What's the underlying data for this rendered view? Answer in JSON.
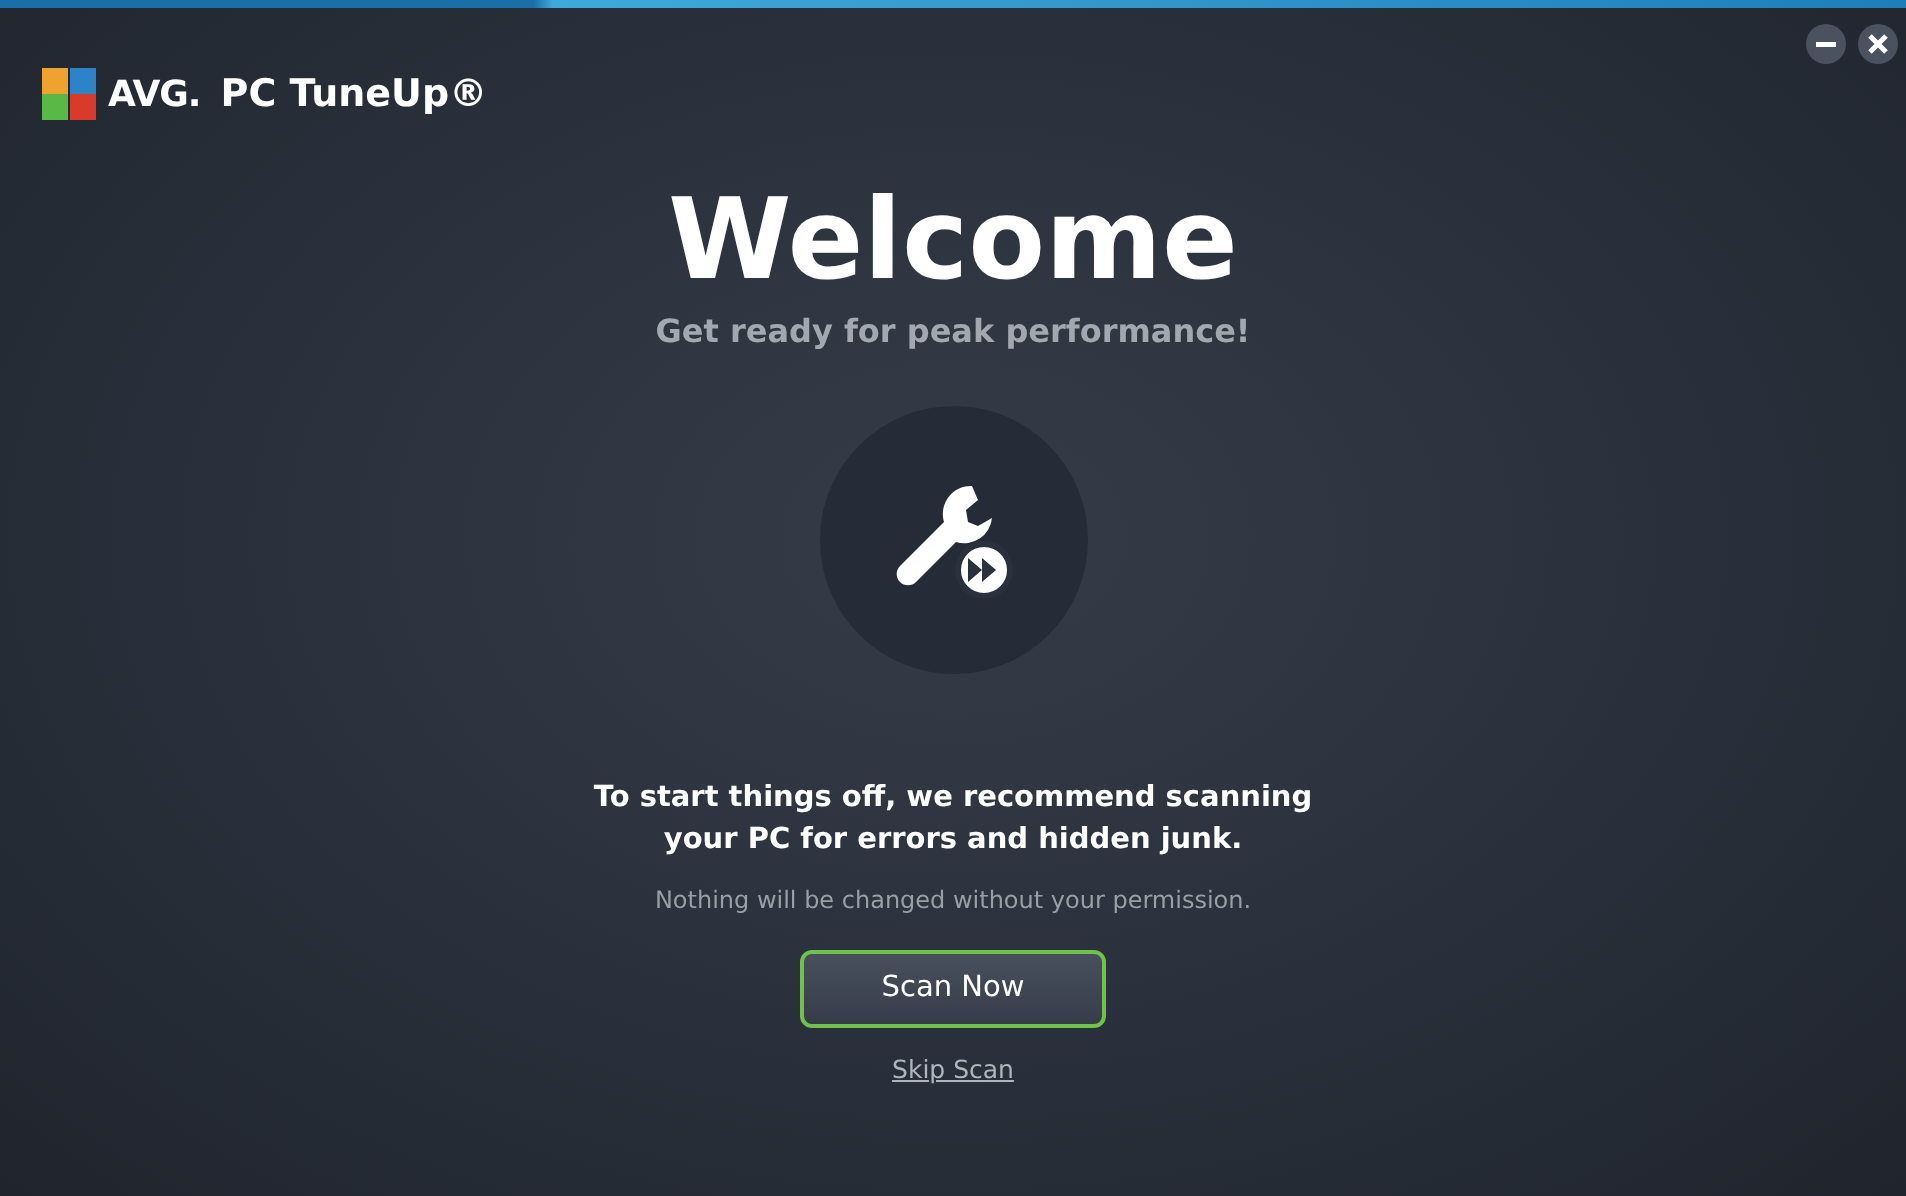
{
  "app": {
    "brand": "AVG.",
    "product": "PC TuneUp®"
  },
  "window_controls": [
    {
      "kind": "minimize"
    },
    {
      "kind": "close"
    }
  ],
  "hero": {
    "title": "Welcome",
    "subtitle": "Get ready for peak performance!"
  },
  "message": {
    "lead": "To start things off, we recommend scanning your PC for errors and hidden junk.",
    "note": "Nothing will be changed without your permission."
  },
  "primary_button": "Scan Now",
  "skip_link": "Skip Scan"
}
